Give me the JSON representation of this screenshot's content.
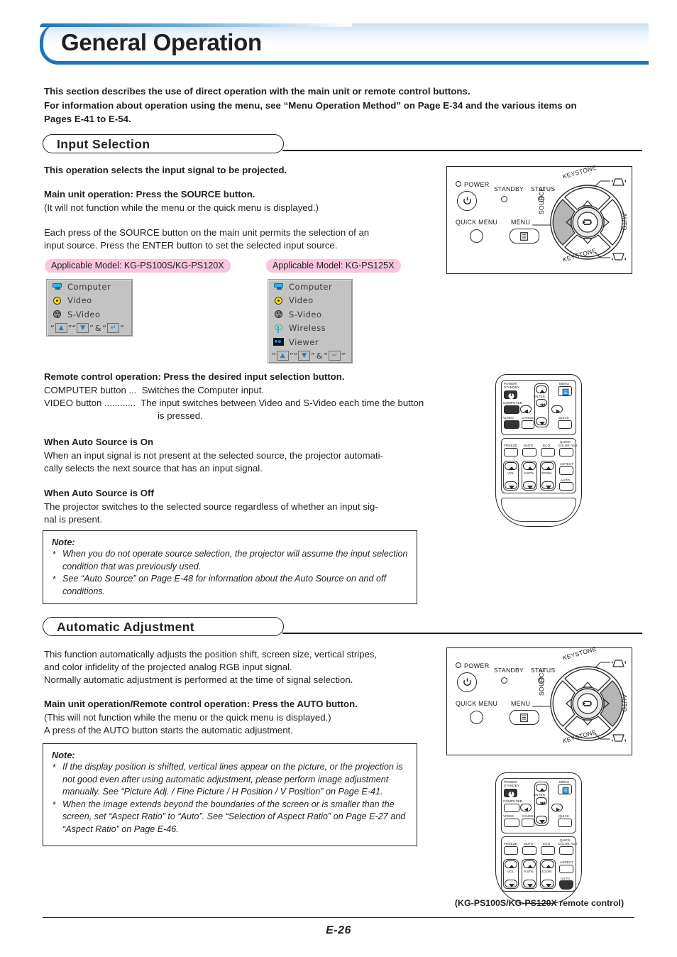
{
  "page": {
    "title": "General Operation",
    "footer_page": "E-26"
  },
  "intro": {
    "line1": "This section describes the use of direct operation with the main unit or remote control buttons.",
    "line2": "For information about operation using the menu, see “Menu Operation Method” on Page E-34 and the various items on",
    "line3": "Pages E-41 to E-54."
  },
  "input_selection": {
    "heading": "Input Selection",
    "lead": "This operation selects the input signal to be projected.",
    "main_unit_heading": "Main unit operation: Press the SOURCE button.",
    "main_unit_note": "(It will not function while the menu or the quick menu is displayed.)",
    "para_line1": "Each press of the SOURCE button on the main unit permits the selection of an",
    "para_line2": "input source. Press the ENTER button to set the selected input source.",
    "badge_left": "Applicable Model: KG-PS100S/KG-PS120X",
    "badge_right": "Applicable Model: KG-PS125X",
    "osd_left": {
      "items": [
        {
          "icon": "monitor-icon",
          "label": "Computer"
        },
        {
          "icon": "video-rca-icon",
          "label": "Video"
        },
        {
          "icon": "s-video-din-icon",
          "label": "S-Video"
        }
      ],
      "key_hint": {
        "q1": "”",
        "amp": "&",
        "q2": "”"
      }
    },
    "osd_right": {
      "items": [
        {
          "icon": "monitor-icon",
          "label": "Computer"
        },
        {
          "icon": "video-rca-icon",
          "label": "Video"
        },
        {
          "icon": "s-video-din-icon",
          "label": "S-Video"
        },
        {
          "icon": "wireless-antenna-icon",
          "label": "Wireless"
        },
        {
          "icon": "viewer-binoculars-icon",
          "label": "Viewer"
        }
      ],
      "key_hint": {
        "q1": "”",
        "amp": "&",
        "q2": "”"
      }
    },
    "remote_heading": "Remote control operation: Press the desired input selection button.",
    "remote_line1": "COMPUTER button ...  Switches the Computer input.",
    "remote_line2": "VIDEO button ............  The input switches between Video and S-Video each time the button",
    "remote_line3": "is pressed.",
    "auto_on_heading": "When Auto Source is On",
    "auto_on_line1": "When an input signal is not present at the selected source, the projector automati-",
    "auto_on_line2": "cally selects the next source that has an input signal.",
    "auto_off_heading": "When Auto Source is Off",
    "auto_off_line1": "The projector switches to the selected source regardless of whether an input sig-",
    "auto_off_line2": "nal is present.",
    "note": {
      "title": "Note:",
      "items": [
        "When you do not operate source selection, the projector will assume the input selection condition that was previously used.",
        "See “Auto Source” on Page E-48 for information about the Auto Source on and off conditions."
      ]
    }
  },
  "automatic_adjustment": {
    "heading": "Automatic Adjustment",
    "para_line1": "This function automatically adjusts the position shift, screen size, vertical stripes,",
    "para_line2": "and color infidelity of the projected analog RGB input signal.",
    "para_line3": "Normally automatic adjustment is performed at the time of signal selection.",
    "op_heading": "Main unit operation/Remote control operation: Press the AUTO button.",
    "op_line1": "(This will not function while the menu or the quick menu is displayed.)",
    "op_line2": "A press of the AUTO button starts the automatic adjustment.",
    "note": {
      "title": "Note:",
      "items": [
        "If the display position is shifted, vertical lines appear on the picture, or the projection is not good even after using automatic adjustment, please perform image adjustment manually. See “Picture Adj. / Fine Picture / H Position / V Position” on Page E-41.",
        "When the image extends beyond the boundaries of the screen or is smaller than the screen, set “Aspect Ratio” to “Auto”. See “Selection of Aspect Ratio” on Page E-27 and “Aspect Ratio” on Page E-46."
      ]
    }
  },
  "control_panel": {
    "power": "POWER",
    "standby": "STANDBY",
    "status": "STATUS",
    "quick_menu": "QUICK MENU",
    "menu": "MENU",
    "keystone_top": "KEYSTONE",
    "keystone_bottom": "KEYSTONE",
    "source": "SOURCE",
    "auto": "AUTO"
  },
  "remote": {
    "power_standby_l1": "POWER/",
    "power_standby_l2": "STANDBY",
    "menu": "MENU",
    "computer": "COMPUTER",
    "video": "VIDEO",
    "enter": "ENTER",
    "cancel": "CANCEL",
    "quick": "QUICK",
    "freeze": "FREEZE",
    "mute": "MUTE",
    "eco": "ECO",
    "quick_color_l1": "QUICK",
    "quick_color_l2": "COLOR ADJ",
    "aspect": "ASPECT",
    "vol": "VOL",
    "kstn": "KSTN",
    "zoom": "ZOOM",
    "auto": "AUTO",
    "caption": "(KG-PS100S/KG-PS120X remote control)"
  },
  "colors": {
    "accent_blue": "#1c75bc",
    "badge_pink": "#f8c6de",
    "osd_gray": "#c3c3c3",
    "ink": "#231f20"
  }
}
